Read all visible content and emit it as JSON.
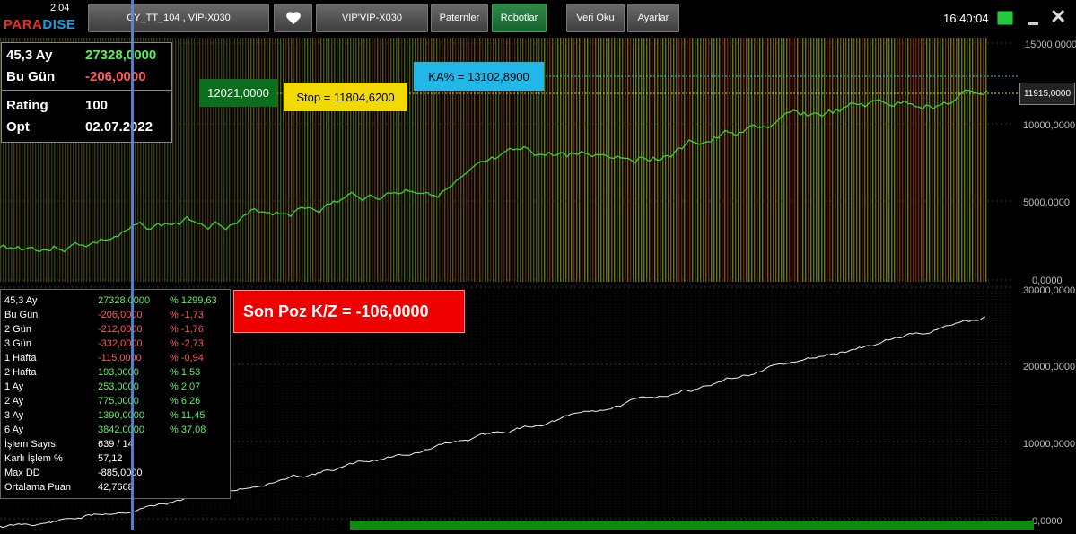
{
  "app": {
    "version": "2.04",
    "logo_part1": "PARA",
    "logo_part2": "DISE",
    "clock": "16:40:04"
  },
  "toolbar": {
    "strategy_label": "CY_TT_104  ,  VIP-X030",
    "symbol_label": "VIP'VIP-X030",
    "patterns_label": "Paternler",
    "robots_label": "Robotlar",
    "data_read_label": "Veri Oku",
    "settings_label": "Ayarlar",
    "favorite_icon": "heart-icon"
  },
  "summary_box": {
    "row1_label": "45,3 Ay",
    "row1_value": "27328,0000",
    "row2_label": "Bu Gün",
    "row2_value": "-206,0000",
    "row3_label": "Rating",
    "row3_value": "100",
    "row4_label": "Opt",
    "row4_value": "02.07.2022"
  },
  "tags": {
    "entry_price": "12021,0000",
    "stop": "Stop = 11804,6200",
    "ka": "KA% = 13102,8900",
    "current_price": "11915,0000"
  },
  "top_axis": {
    "ticks": [
      "15000,0000",
      "10000,0000",
      "5000,0000",
      "0,0000"
    ]
  },
  "bottom_axis": {
    "ticks": [
      "30000,0000",
      "20000,0000",
      "10000,0000",
      "0,0000"
    ]
  },
  "son_poz": "Son Poz K/Z  =  -106,0000",
  "performance": [
    {
      "label": "45,3 Ay",
      "amount": "27328,0000",
      "pct": "% 1299,63",
      "sign": "pos"
    },
    {
      "label": "Bu Gün",
      "amount": "-206,0000",
      "pct": "% -1,73",
      "sign": "neg"
    },
    {
      "label": "2 Gün",
      "amount": "-212,0000",
      "pct": "% -1,76",
      "sign": "neg"
    },
    {
      "label": "3 Gün",
      "amount": "-332,0000",
      "pct": "% -2,73",
      "sign": "neg"
    },
    {
      "label": "1 Hafta",
      "amount": "-115,0000",
      "pct": "% -0,94",
      "sign": "neg"
    },
    {
      "label": "2 Hafta",
      "amount": "193,0000",
      "pct": "% 1,53",
      "sign": "pos"
    },
    {
      "label": "1 Ay",
      "amount": "253,0000",
      "pct": "% 2,07",
      "sign": "pos"
    },
    {
      "label": "2 Ay",
      "amount": "775,0000",
      "pct": "% 6,26",
      "sign": "pos"
    },
    {
      "label": "3 Ay",
      "amount": "1390,0000",
      "pct": "% 11,45",
      "sign": "pos"
    },
    {
      "label": "6 Ay",
      "amount": "3842,0000",
      "pct": "% 37,08",
      "sign": "pos"
    }
  ],
  "trade_stats": [
    {
      "label": "İşlem Sayısı",
      "value": "639 / 14"
    },
    {
      "label": "Karlı İşlem %",
      "value": "57,12"
    },
    {
      "label": "Max DD",
      "value": "-885,0000"
    },
    {
      "label": "Ortalama Puan",
      "value": "42,7668"
    }
  ],
  "colors": {
    "positive": "#5cf05c",
    "negative": "#ff5a5a",
    "stop_tag": "#f2d900",
    "ka_tag": "#1fb8e8",
    "entry_tag": "#0b6e1c",
    "son_poz_bg": "#ee0000"
  }
}
